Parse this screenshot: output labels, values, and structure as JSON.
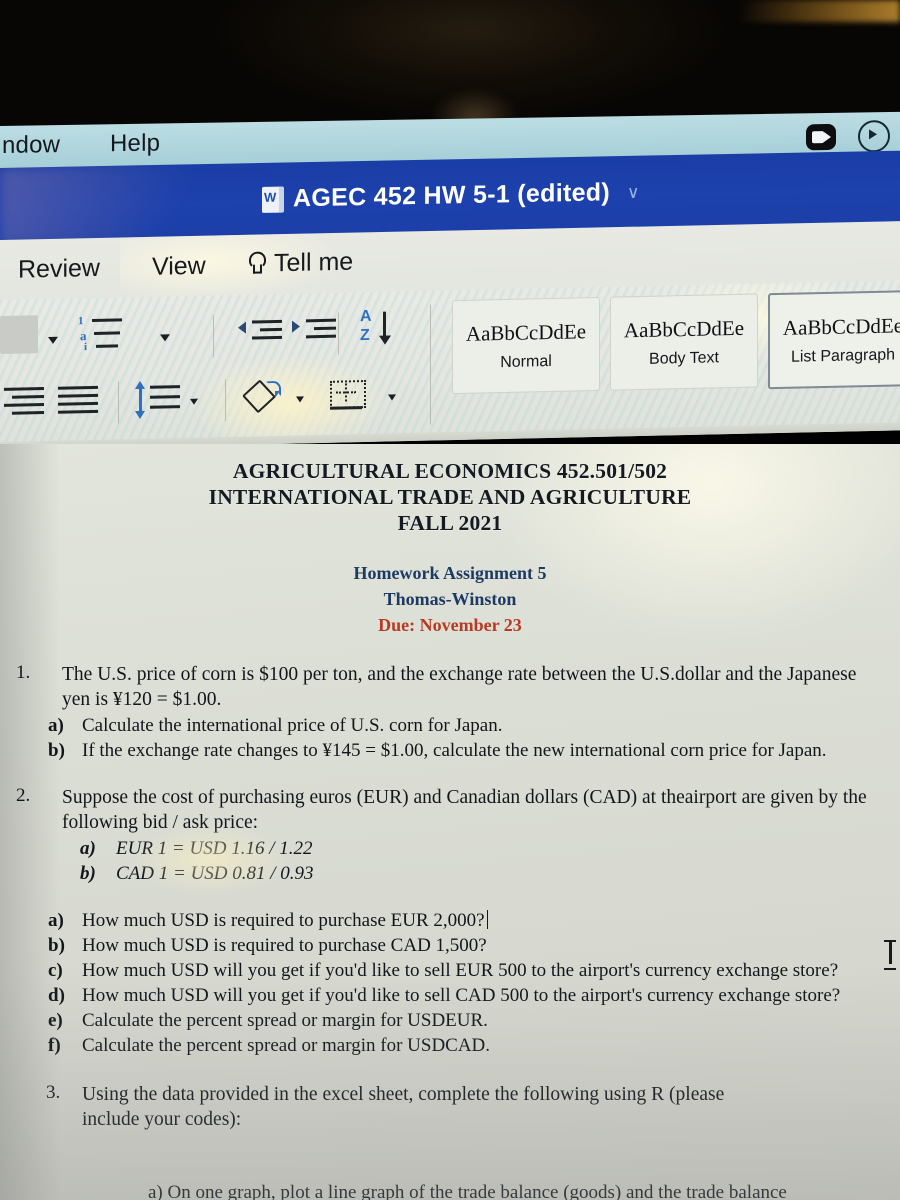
{
  "menubar": {
    "items": [
      {
        "label": "ndow"
      },
      {
        "label": "Help"
      }
    ],
    "icons": {
      "zoom": "zoom-camera-icon",
      "play": "media-play-icon"
    }
  },
  "titlebar": {
    "doc_icon": "word-document-icon",
    "title": "AGEC 452 HW 5-1 (edited)",
    "chevron": "∨",
    "color": "#1d41ad"
  },
  "ribbon": {
    "tabs": [
      {
        "label": "Review"
      },
      {
        "label": "View"
      }
    ],
    "tell_me": {
      "label": "Tell me",
      "icon": "lightbulb-icon"
    },
    "tools": [
      {
        "name": "multilevel-list-button",
        "glyph": "1 a i"
      },
      {
        "name": "decrease-indent-button"
      },
      {
        "name": "increase-indent-button"
      },
      {
        "name": "sort-az-button",
        "glyph": "A Z"
      },
      {
        "name": "show-formatting-marks-button",
        "glyph": "¶"
      },
      {
        "name": "align-right-button"
      },
      {
        "name": "justify-button"
      },
      {
        "name": "line-spacing-button"
      },
      {
        "name": "shading-button"
      },
      {
        "name": "borders-button"
      }
    ],
    "styles": [
      {
        "preview": "AaBbCcDdEe",
        "name": "Normal",
        "selected": false
      },
      {
        "preview": "AaBbCcDdEе",
        "name": "Body Text",
        "selected": false
      },
      {
        "preview": "AaBbCcDdEе",
        "name": "List Paragraph",
        "selected": true
      }
    ]
  },
  "document": {
    "header": {
      "lines": [
        "AGRICULTURAL ECONOMICS 452.501/502",
        "INTERNATIONAL TRADE AND AGRICULTURE",
        "FALL 2021"
      ],
      "assignment": "Homework Assignment 5",
      "instructor": "Thomas-Winston",
      "due": "Due: November 23",
      "due_color": "#b73a22",
      "sub_color": "#1d3a63"
    },
    "questions": [
      {
        "number": "1.",
        "text": "The U.S. price of corn is $100 per ton, and the exchange rate between the U.S.dollar and the Japanese yen is ¥120 = $1.00.",
        "items": [
          {
            "label": "a)",
            "text": "Calculate the international price of U.S. corn for Japan.",
            "italic": false
          },
          {
            "label": "b)",
            "text": "If the exchange rate changes to ¥145 = $1.00, calculate the new international corn price for Japan.",
            "italic": false
          }
        ]
      },
      {
        "number": "2.",
        "text": "Suppose the cost of purchasing euros (EUR) and Canadian dollars (CAD) at theairport are given by the following bid / ask price:",
        "items": [
          {
            "label": "a)",
            "text": "EUR 1 = USD 1.16 / 1.22",
            "italic": true
          },
          {
            "label": "b)",
            "text": "CAD 1 = USD 0.81 / 0.93",
            "italic": true
          }
        ],
        "items2": [
          {
            "label": "a)",
            "text": "How much USD is required to purchase EUR 2,000?",
            "caret": true
          },
          {
            "label": "b)",
            "text": "How much USD is required to purchase CAD 1,500?",
            "caret": false
          },
          {
            "label": "c)",
            "text": "How much USD will you get if you'd like to sell EUR 500 to the airport's currency exchange store?",
            "caret": false
          },
          {
            "label": "d)",
            "text": "How much USD will you get if you'd like to sell CAD 500 to the airport's currency exchange store?",
            "caret": false
          },
          {
            "label": "e)",
            "text": "Calculate the percent spread or margin for USDEUR.",
            "caret": false
          },
          {
            "label": "f)",
            "text": "Calculate the percent spread or margin for USDCAD.",
            "caret": false
          }
        ]
      },
      {
        "number": "3.",
        "text": "Using the data provided in the excel sheet, complete the following using R (please include your codes):",
        "items": []
      }
    ],
    "cut_off_line": "a)   On one graph, plot a line graph of the trade balance (goods) and the trade balance",
    "cursor": "text-ibeam-cursor"
  }
}
